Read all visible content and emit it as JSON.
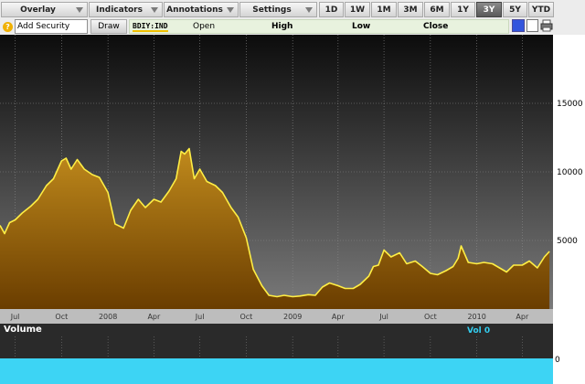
{
  "toolbar": {
    "overlay": "Overlay",
    "indicators": "Indicators",
    "annotations": "Annotations",
    "settings": "Settings",
    "ranges": [
      "1D",
      "1W",
      "1M",
      "3M",
      "6M",
      "1Y",
      "3Y",
      "5Y",
      "YTD"
    ],
    "active_range": "3Y"
  },
  "row2": {
    "add_security_placeholder": "Add Security",
    "draw": "Draw",
    "ticker": "BDIY:IND",
    "open": "Open",
    "high": "High",
    "low": "Low",
    "close": "Close"
  },
  "volume": {
    "label": "Volume",
    "value": "Vol 0",
    "axis_tick": "0"
  },
  "colors": {
    "line": "#ffee44",
    "fill_top": "#c08a1c",
    "fill_bottom": "#6a3d00",
    "volume": "#3dd4f4"
  },
  "chart_data": {
    "type": "area",
    "ylim": [
      0,
      20000
    ],
    "yticks": [
      5000,
      10000,
      15000
    ],
    "ytick_labels": [
      "5000",
      "10000",
      "15000"
    ],
    "xlim": [
      "2007-06-01",
      "2010-06-01"
    ],
    "xticks": [
      {
        "date": "2007-07-01",
        "label": "Jul"
      },
      {
        "date": "2007-10-01",
        "label": "Oct"
      },
      {
        "date": "2008-01-01",
        "label": "2008"
      },
      {
        "date": "2008-04-01",
        "label": "Apr"
      },
      {
        "date": "2008-07-01",
        "label": "Jul"
      },
      {
        "date": "2008-10-01",
        "label": "Oct"
      },
      {
        "date": "2009-01-01",
        "label": "2009"
      },
      {
        "date": "2009-04-01",
        "label": "Apr"
      },
      {
        "date": "2009-07-01",
        "label": "Jul"
      },
      {
        "date": "2009-10-01",
        "label": "Oct"
      },
      {
        "date": "2010-01-01",
        "label": "2010"
      },
      {
        "date": "2010-04-01",
        "label": "Apr"
      }
    ],
    "x": [
      "2007-06-01",
      "2007-06-10",
      "2007-06-20",
      "2007-07-01",
      "2007-07-15",
      "2007-08-01",
      "2007-08-15",
      "2007-09-01",
      "2007-09-15",
      "2007-10-01",
      "2007-10-10",
      "2007-10-20",
      "2007-11-01",
      "2007-11-15",
      "2007-12-01",
      "2007-12-15",
      "2008-01-01",
      "2008-01-15",
      "2008-02-01",
      "2008-02-15",
      "2008-03-01",
      "2008-03-15",
      "2008-04-01",
      "2008-04-15",
      "2008-05-01",
      "2008-05-15",
      "2008-05-25",
      "2008-06-01",
      "2008-06-10",
      "2008-06-20",
      "2008-07-01",
      "2008-07-15",
      "2008-08-01",
      "2008-08-15",
      "2008-09-01",
      "2008-09-15",
      "2008-10-01",
      "2008-10-15",
      "2008-11-01",
      "2008-11-15",
      "2008-12-01",
      "2008-12-15",
      "2009-01-01",
      "2009-01-15",
      "2009-02-01",
      "2009-02-15",
      "2009-03-01",
      "2009-03-15",
      "2009-04-01",
      "2009-04-15",
      "2009-05-01",
      "2009-05-15",
      "2009-06-01",
      "2009-06-10",
      "2009-06-20",
      "2009-07-01",
      "2009-07-15",
      "2009-08-01",
      "2009-08-15",
      "2009-09-01",
      "2009-09-15",
      "2009-10-01",
      "2009-10-15",
      "2009-11-01",
      "2009-11-15",
      "2009-11-25",
      "2009-12-01",
      "2009-12-15",
      "2010-01-01",
      "2010-01-15",
      "2010-02-01",
      "2010-02-15",
      "2010-03-01",
      "2010-03-15",
      "2010-04-01",
      "2010-04-15",
      "2010-05-01",
      "2010-05-15",
      "2010-05-25"
    ],
    "values": [
      6100,
      5500,
      6300,
      6500,
      7000,
      7500,
      8000,
      9000,
      9500,
      10800,
      11000,
      10200,
      10900,
      10200,
      9800,
      9600,
      8500,
      6200,
      5900,
      7200,
      8000,
      7400,
      8000,
      7800,
      8600,
      9500,
      11500,
      11300,
      11700,
      9500,
      10200,
      9300,
      9000,
      8500,
      7400,
      6700,
      5200,
      2900,
      1700,
      1000,
      900,
      1000,
      900,
      950,
      1050,
      1000,
      1600,
      1900,
      1700,
      1500,
      1500,
      1800,
      2400,
      3100,
      3200,
      4300,
      3800,
      4100,
      3300,
      3500,
      3100,
      2600,
      2500,
      2800,
      3100,
      3700,
      4600,
      3400,
      3300,
      3400,
      3300,
      3000,
      2700,
      3200,
      3200,
      3500,
      3000,
      3800,
      4200
    ]
  }
}
